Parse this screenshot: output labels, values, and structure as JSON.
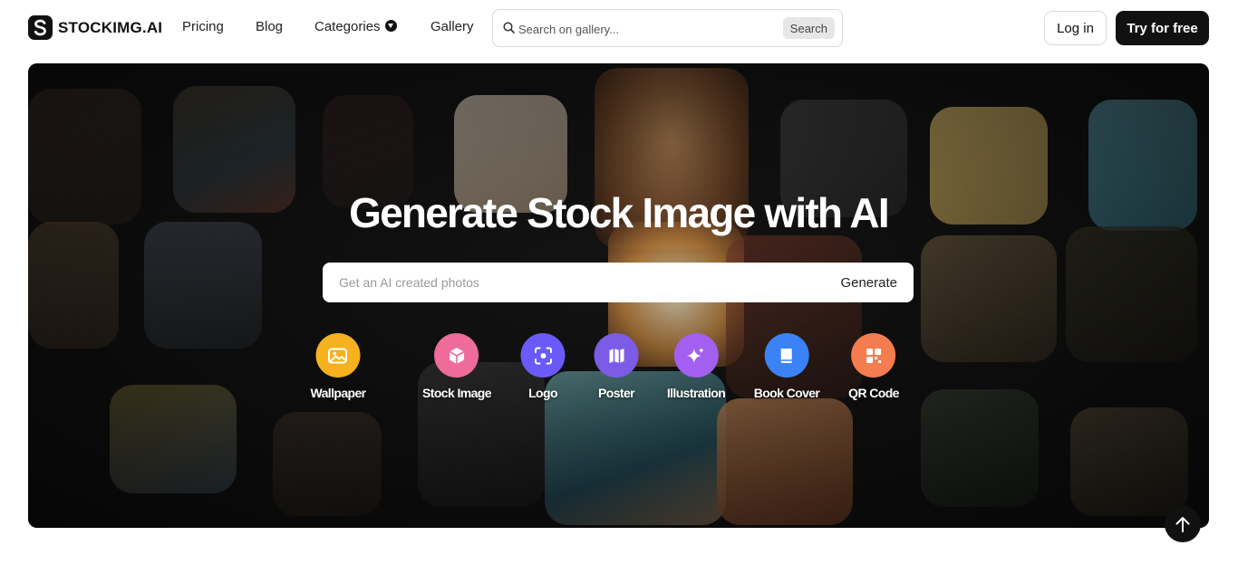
{
  "header": {
    "logo_text": "STOCKIMG.AI",
    "nav": {
      "pricing": "Pricing",
      "blog": "Blog",
      "categories": "Categories",
      "gallery": "Gallery"
    },
    "search": {
      "placeholder": "Search on gallery...",
      "button": "Search"
    },
    "login": "Log in",
    "try_free": "Try for free"
  },
  "hero": {
    "title": "Generate Stock Image  with AI",
    "generate_placeholder": "Get an AI created photos",
    "generate_button": "Generate",
    "categories": [
      {
        "label": "Wallpaper",
        "icon": "image-icon",
        "color": "#f5b21e"
      },
      {
        "label": "Stock Image",
        "icon": "cube-icon",
        "color": "#ee6b9a"
      },
      {
        "label": "Logo",
        "icon": "focus-icon",
        "color": "#6a5af9"
      },
      {
        "label": "Poster",
        "icon": "map-icon",
        "color": "#7c5ce6"
      },
      {
        "label": "Illustration",
        "icon": "sparkles-icon",
        "color": "#a25ff0"
      },
      {
        "label": "Book Cover",
        "icon": "book-icon",
        "color": "#3b82f6"
      },
      {
        "label": "QR Code",
        "icon": "qr-code-icon",
        "color": "#f47c4e"
      }
    ]
  },
  "colors": {
    "brand_dark": "#111111",
    "hero_bg": "#141414"
  }
}
